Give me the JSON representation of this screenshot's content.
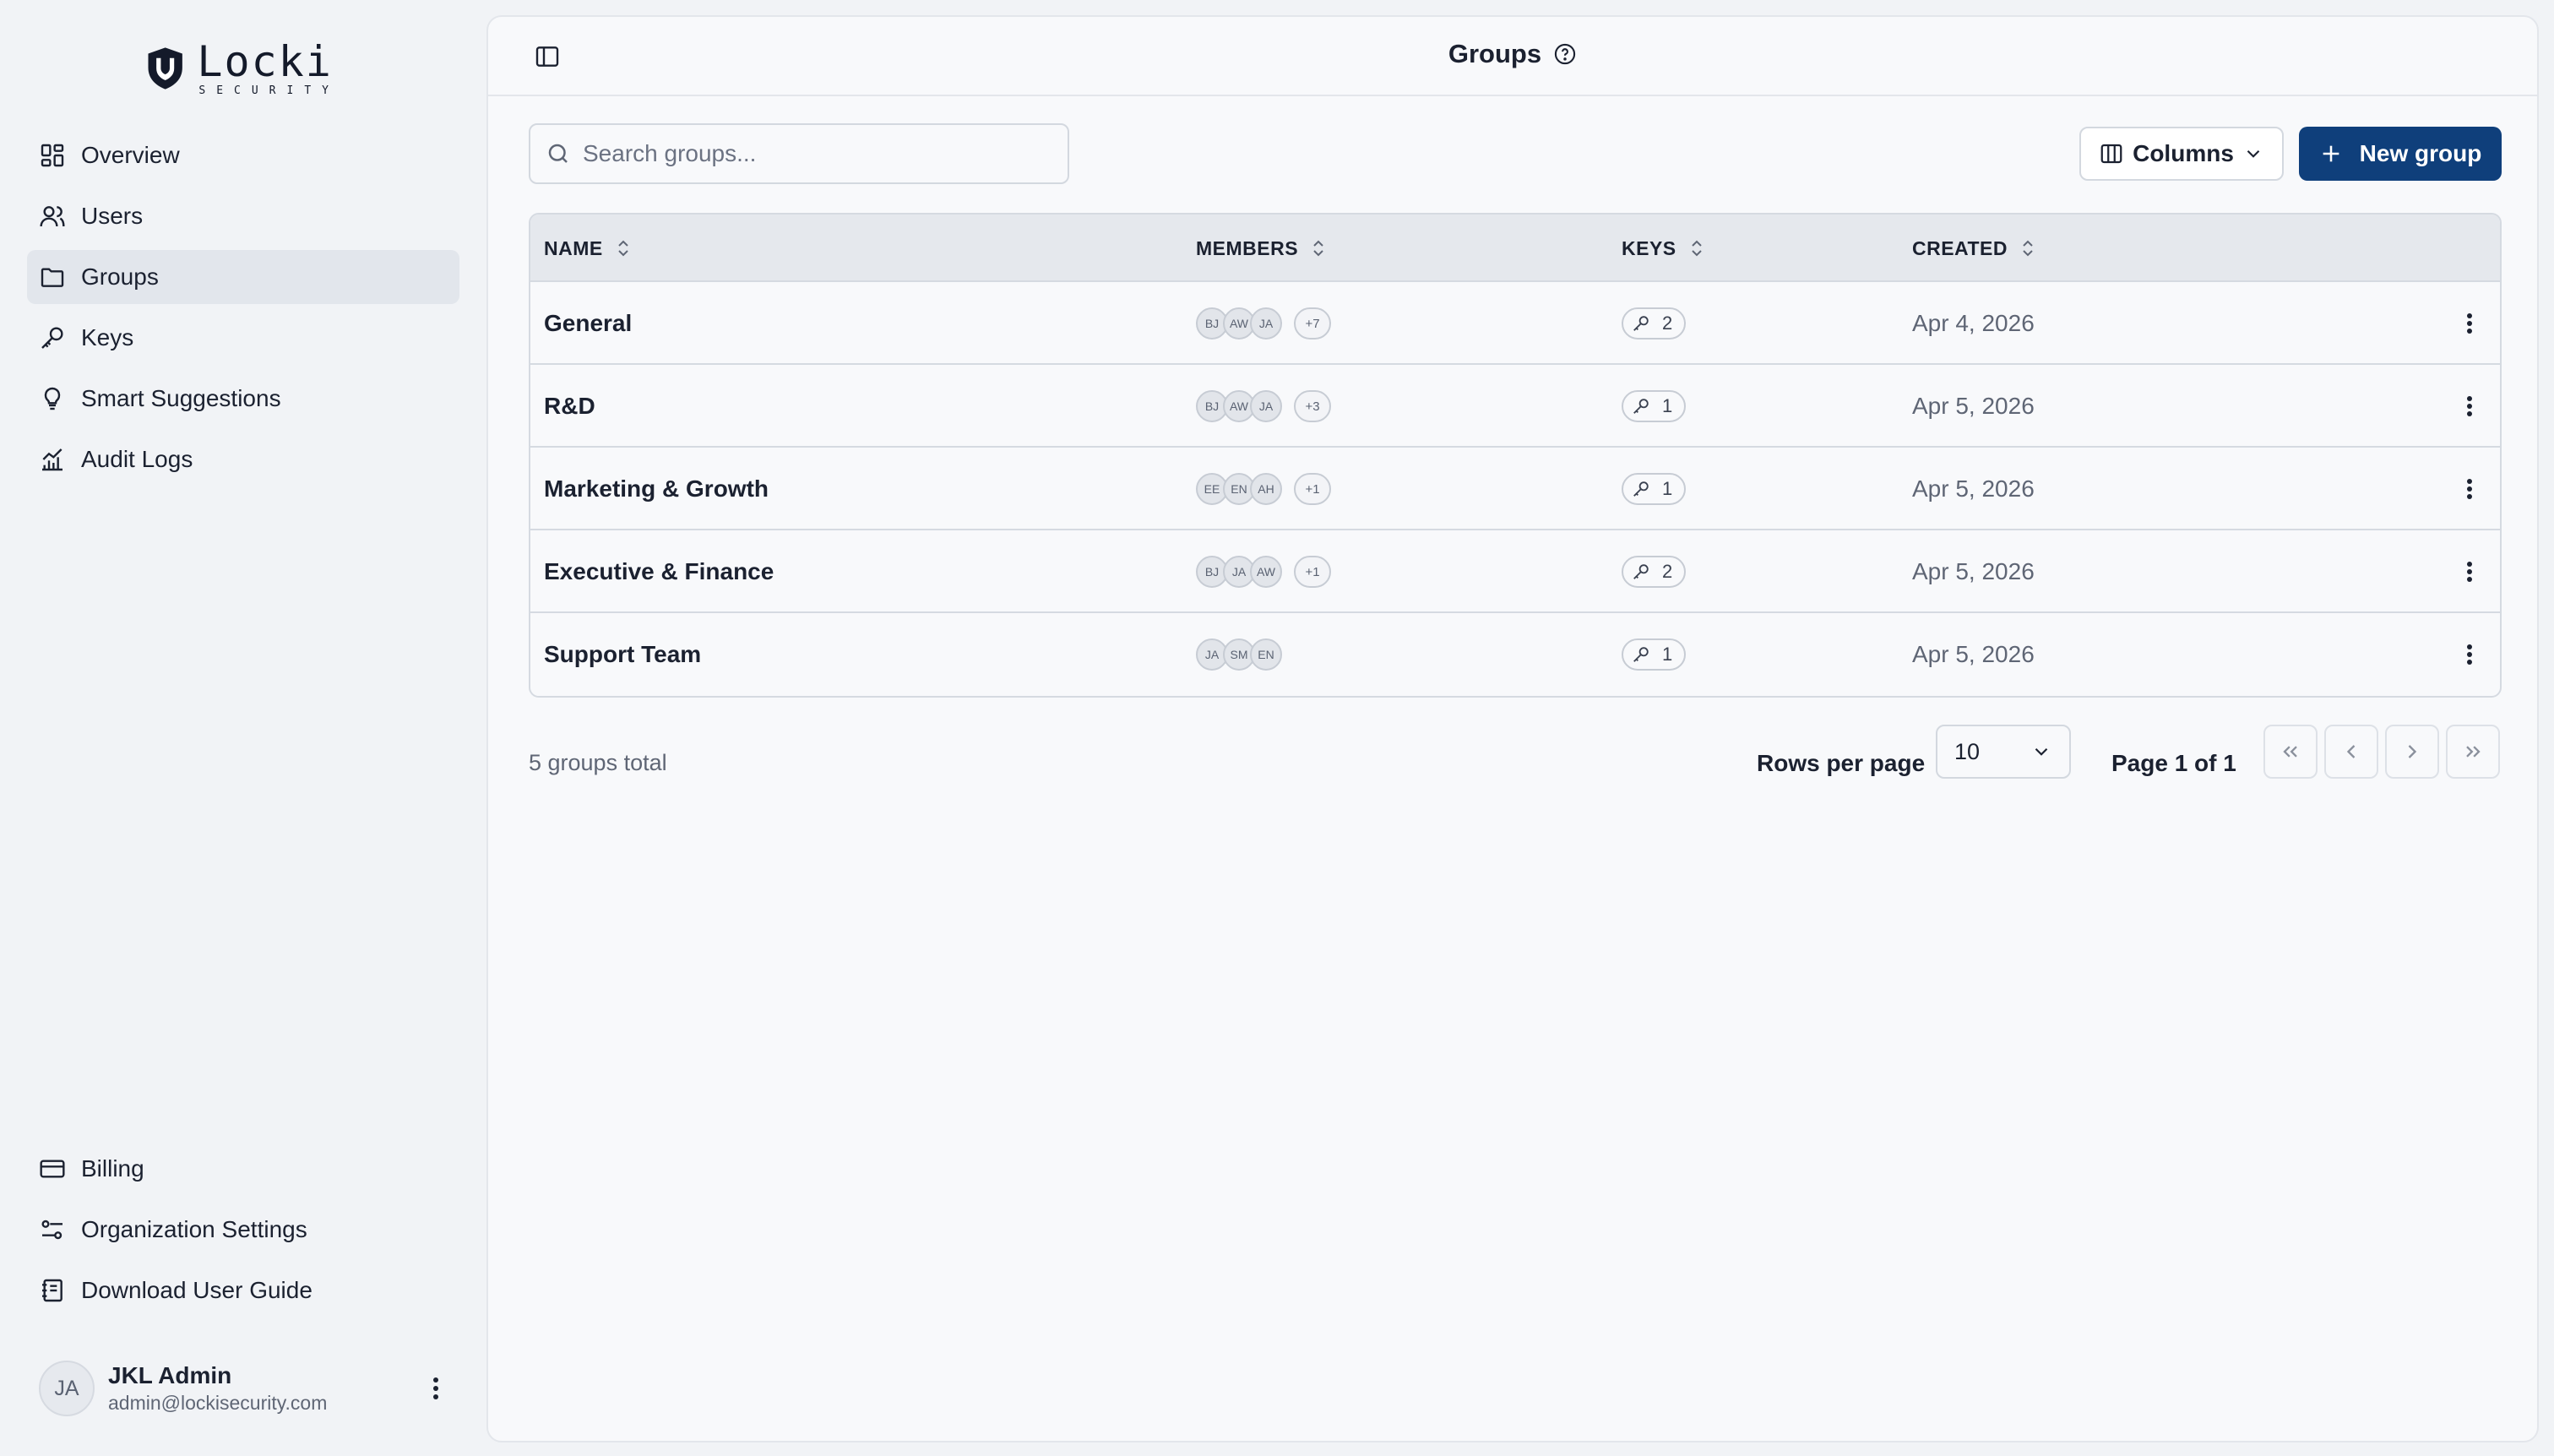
{
  "brand": {
    "name": "Locki",
    "tagline": "SECURITY"
  },
  "sidebar": {
    "items": [
      {
        "label": "Overview",
        "icon": "dashboard-icon"
      },
      {
        "label": "Users",
        "icon": "users-icon"
      },
      {
        "label": "Groups",
        "icon": "folder-icon",
        "active": true
      },
      {
        "label": "Keys",
        "icon": "key-icon"
      },
      {
        "label": "Smart Suggestions",
        "icon": "lightbulb-icon"
      },
      {
        "label": "Audit Logs",
        "icon": "chart-icon"
      }
    ],
    "bottom_items": [
      {
        "label": "Billing",
        "icon": "credit-card-icon"
      },
      {
        "label": "Organization Settings",
        "icon": "settings-sliders-icon"
      },
      {
        "label": "Download User Guide",
        "icon": "book-icon"
      }
    ],
    "user": {
      "initials": "JA",
      "name": "JKL Admin",
      "email": "admin@lockisecurity.com"
    }
  },
  "header": {
    "title": "Groups"
  },
  "toolbar": {
    "search_placeholder": "Search groups...",
    "columns_label": "Columns",
    "new_group_label": "New group"
  },
  "table": {
    "columns": [
      "NAME",
      "MEMBERS",
      "KEYS",
      "CREATED"
    ],
    "rows": [
      {
        "name": "General",
        "members": [
          "BJ",
          "AW",
          "JA"
        ],
        "more": "+7",
        "keys": "2",
        "created": "Apr 4, 2026"
      },
      {
        "name": "R&D",
        "members": [
          "BJ",
          "AW",
          "JA"
        ],
        "more": "+3",
        "keys": "1",
        "created": "Apr 5, 2026"
      },
      {
        "name": "Marketing & Growth",
        "members": [
          "EE",
          "EN",
          "AH"
        ],
        "more": "+1",
        "keys": "1",
        "created": "Apr 5, 2026"
      },
      {
        "name": "Executive & Finance",
        "members": [
          "BJ",
          "JA",
          "AW"
        ],
        "more": "+1",
        "keys": "2",
        "created": "Apr 5, 2026"
      },
      {
        "name": "Support Team",
        "members": [
          "JA",
          "SM",
          "EN"
        ],
        "more": "",
        "keys": "1",
        "created": "Apr 5, 2026"
      }
    ]
  },
  "footer": {
    "total": "5 groups total",
    "rows_per_page_label": "Rows per page",
    "rows_per_page_value": "10",
    "page_info": "Page 1 of 1"
  },
  "colors": {
    "accent": "#0f3f7b",
    "active_nav": "#e2e6ec"
  }
}
